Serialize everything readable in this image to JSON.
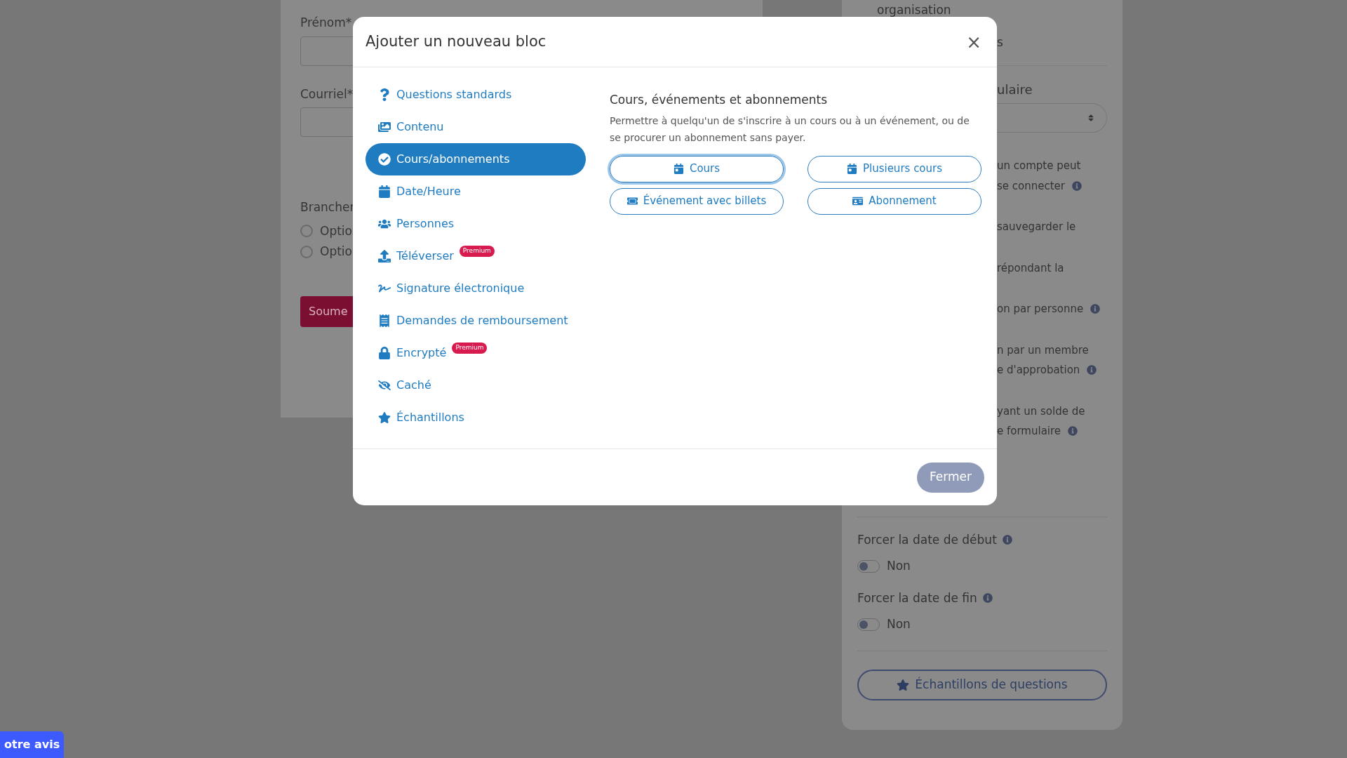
{
  "form": {
    "fields": [
      {
        "label": "Prénom*"
      },
      {
        "label": "Courriel*"
      }
    ],
    "branch": {
      "label": "Brancher",
      "options": [
        {
          "label": "Optio",
          "checked": false
        },
        {
          "label": "Optio",
          "checked": false
        }
      ]
    },
    "submit": "Soume"
  },
  "settings": {
    "top": [
      "organisation",
      "s"
    ],
    "section_title": "ulaire",
    "notes": [
      {
        "text": "un compte peut"
      },
      {
        "text": "se connecter",
        "info": true
      },
      {
        "text": "sauvegarder le"
      },
      {
        "text": "répondant la"
      },
      {
        "text": "on par personne",
        "info": true
      },
      {
        "text": "n par un membre"
      },
      {
        "text": "e d'approbation",
        "info": true
      },
      {
        "text": "yant un solde de"
      },
      {
        "text": "e formulaire",
        "info": true
      }
    ],
    "toggles": [
      {
        "label": "Forcer la date de début",
        "on": false,
        "value": "Non"
      },
      {
        "label": "Forcer la date de fin",
        "on": false,
        "value": "Non"
      }
    ],
    "samples_button": "Échantillons de questions"
  },
  "feedback": "otre avis",
  "dialog": {
    "title": "Ajouter un nouveau bloc",
    "close": "×",
    "nav": [
      {
        "label": "Questions standards",
        "selected": false
      },
      {
        "label": "Contenu",
        "selected": false
      },
      {
        "label": "Cours/abonnements",
        "selected": true
      },
      {
        "label": "Date/Heure",
        "selected": false
      },
      {
        "label": "Personnes",
        "selected": false
      },
      {
        "label": "Téléverser",
        "selected": false,
        "badge": "Premium"
      },
      {
        "label": "Signature électronique",
        "selected": false
      },
      {
        "label": "Demandes de remboursement",
        "selected": false
      },
      {
        "label": "Encrypté",
        "selected": false,
        "badge": "Premium"
      },
      {
        "label": "Caché",
        "selected": false
      },
      {
        "label": "Échantillons",
        "selected": false
      }
    ],
    "panel": {
      "title": "Cours, événements et abonnements",
      "description": "Permettre à quelqu'un de s'inscrire à un cours ou à un événement, ou de se procurer un abonnement sans payer.",
      "buttons": [
        {
          "label": "Cours",
          "focused": true
        },
        {
          "label": "Plusieurs cours",
          "focused": false
        },
        {
          "label": "Événement avec billets",
          "focused": false
        },
        {
          "label": "Abonnement",
          "focused": false
        }
      ]
    },
    "footer_button": "Fermer"
  }
}
